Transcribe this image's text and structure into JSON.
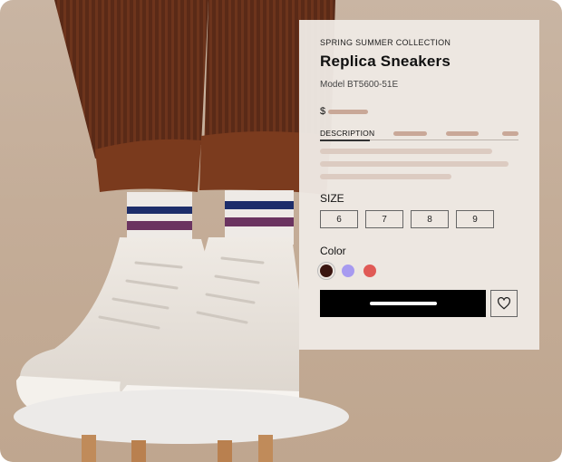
{
  "product": {
    "collection": "SPRING SUMMER COLLECTION",
    "name": "Replica Sneakers",
    "model": "Model BT5600-51E",
    "currency": "$",
    "tabs": {
      "active": "DESCRIPTION"
    },
    "size_label": "SIZE",
    "sizes": [
      "6",
      "7",
      "8",
      "9"
    ],
    "color_label": "Color",
    "colors": [
      "#3a1510",
      "#a79af0",
      "#e05a56"
    ],
    "selected_color_index": 0
  },
  "icons": {
    "wishlist": "heart-icon"
  }
}
